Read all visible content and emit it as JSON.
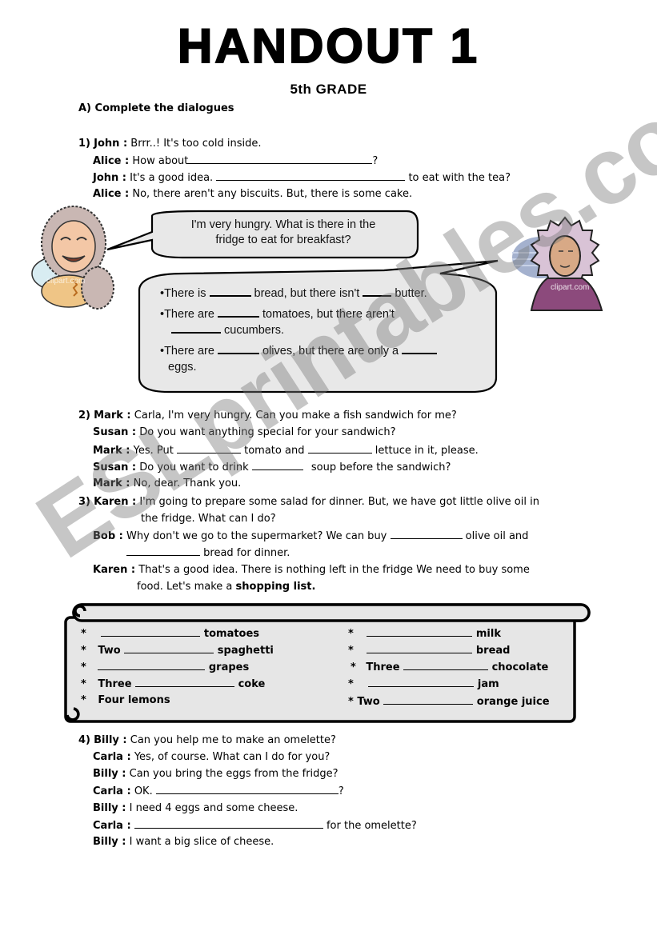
{
  "header": {
    "title": "HANDOUT 1",
    "grade": "5th GRADE",
    "section_a": "A) Complete the dialogues"
  },
  "dialogue1": {
    "number": "1)",
    "lines": [
      {
        "speaker": "John :",
        "text": "Brrr..! It's too cold inside."
      },
      {
        "speaker": "Alice :",
        "pre": "How about",
        "post": "?"
      },
      {
        "speaker": "John :",
        "pre": "It's a good idea.",
        "post": "to eat with the tea?"
      },
      {
        "speaker": "Alice :",
        "text": "No, there aren't any biscuits. But, there is some cake."
      }
    ]
  },
  "bubbles": {
    "question": {
      "line1": "I'm very hungry. What is there in the",
      "line2": "fridge to eat for breakfast?"
    },
    "answer": {
      "bullet": "•",
      "item1": {
        "a": "There is",
        "b": "bread, but there isn't",
        "c": "butter."
      },
      "item2": {
        "a": "There are",
        "b": "tomatoes, but there aren't",
        "c": "cucumbers."
      },
      "item3": {
        "a": "There are",
        "b": "olives, but there are only a",
        "c": "eggs."
      }
    }
  },
  "images": {
    "left_character": "eskimo-grandmother-clipart",
    "left_watermark": "clipart.com",
    "right_character": "eskimo-woman-clipart",
    "right_watermark": "clipart.com"
  },
  "dialogue2": {
    "number": "2)",
    "lines": [
      {
        "speaker": "Mark :",
        "text": "Carla, I'm very hungry. Can you make a fish sandwich for me?"
      },
      {
        "speaker": "Susan :",
        "text": "Do you want anything special for your sandwich?"
      },
      {
        "speaker": "Mark :",
        "pre": "Yes. Put",
        "mid": "tomato and",
        "post": "lettuce in it, please."
      },
      {
        "speaker": "Susan :",
        "pre": "Do you want to drink",
        "post": "soup before the sandwich?"
      },
      {
        "speaker": "Mark :",
        "text": "No, dear. Thank you."
      }
    ]
  },
  "dialogue3": {
    "number": "3)",
    "lines": [
      {
        "speaker": "Karen :",
        "text": "I'm going to prepare some salad for dinner. But, we have got little olive oil in",
        "cont": "the fridge. What can I do?"
      },
      {
        "speaker": "Bob :",
        "pre": "Why don't we go to the supermarket? We can buy",
        "post": "olive oil and",
        "cont": "bread for dinner."
      },
      {
        "speaker": "Karen :",
        "text": "That's a good idea. There is nothing left in the fridge We need to buy some",
        "cont_pre": "food. Let's make a",
        "cont_bold": "shopping list."
      }
    ]
  },
  "shopping_list": {
    "star": "*",
    "left": [
      {
        "prefix": "",
        "item": "tomatoes"
      },
      {
        "prefix": "Two",
        "item": "spaghetti"
      },
      {
        "prefix": "",
        "item": "grapes"
      },
      {
        "prefix": "Three",
        "item": "coke"
      },
      {
        "prefix": "Four lemons",
        "item": ""
      }
    ],
    "right": [
      {
        "prefix": "",
        "item": "milk"
      },
      {
        "prefix": "",
        "item": "bread"
      },
      {
        "prefix": "Three",
        "item": "chocolate"
      },
      {
        "prefix": "",
        "item": "jam"
      },
      {
        "prefix": "Two",
        "item": "orange juice"
      }
    ]
  },
  "dialogue4": {
    "number": "4)",
    "lines": [
      {
        "speaker": "Billy :",
        "text": "Can you help me to make an omelette?"
      },
      {
        "speaker": "Carla :",
        "text": "Yes, of course. What can I do for you?"
      },
      {
        "speaker": "Billy :",
        "text": "Can you bring the eggs from the fridge?"
      },
      {
        "speaker": "Carla :",
        "pre": "OK.",
        "post": "?"
      },
      {
        "speaker": "Billy :",
        "text": "I need 4 eggs and some cheese."
      },
      {
        "speaker": "Carla :",
        "pre": "",
        "post": "for the omelette?"
      },
      {
        "speaker": "Billy :",
        "text": "I want a big slice of cheese."
      }
    ]
  },
  "watermark": "ESLprintables.com"
}
